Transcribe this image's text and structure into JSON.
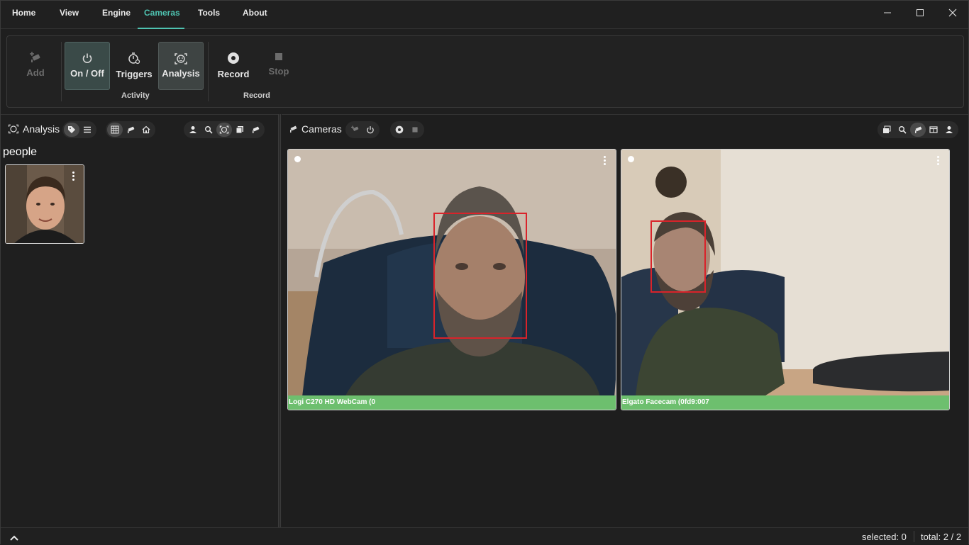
{
  "menu": {
    "items": [
      "Home",
      "View",
      "Engine",
      "Cameras",
      "Tools",
      "About"
    ],
    "active": "Cameras"
  },
  "ribbon": {
    "add": "Add",
    "on_off": "On / Off",
    "triggers": "Triggers",
    "analysis": "Analysis",
    "record": "Record",
    "stop": "Stop",
    "group_activity": "Activity",
    "group_record": "Record"
  },
  "left_panel": {
    "title": "Analysis",
    "group_label": "people"
  },
  "right_panel": {
    "title": "Cameras",
    "cameras": [
      {
        "caption": "Logi C270 HD WebCam (0"
      },
      {
        "caption": "Elgato Facecam (0fd9:007"
      }
    ]
  },
  "status": {
    "selected": "selected: 0",
    "total": "total: 2 / 2"
  },
  "colors": {
    "accent": "#4fc3b1",
    "caption_bar": "#6dbf6e",
    "face_box": "#d9232a"
  }
}
